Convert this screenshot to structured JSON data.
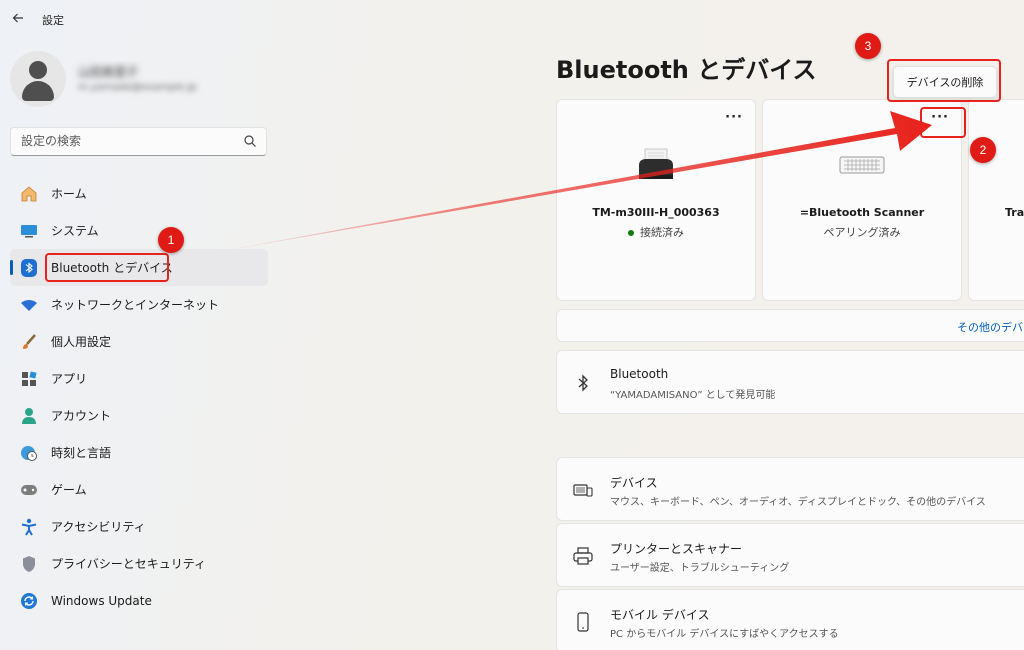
{
  "titlebar": {
    "back_icon": "back-arrow-icon",
    "title": "設定"
  },
  "profile": {
    "name": "山田美里子",
    "email": "m.yamada@example.jp"
  },
  "search": {
    "placeholder": "設定の検索",
    "icon": "search-icon"
  },
  "sidebar": {
    "items": [
      {
        "label": "ホーム",
        "icon": "home-icon"
      },
      {
        "label": "システム",
        "icon": "system-icon"
      },
      {
        "label": "Bluetooth とデバイス",
        "icon": "bluetooth-icon",
        "active": true
      },
      {
        "label": "ネットワークとインターネット",
        "icon": "wifi-icon"
      },
      {
        "label": "個人用設定",
        "icon": "brush-icon"
      },
      {
        "label": "アプリ",
        "icon": "apps-icon"
      },
      {
        "label": "アカウント",
        "icon": "account-icon"
      },
      {
        "label": "時刻と言語",
        "icon": "globe-clock-icon"
      },
      {
        "label": "ゲーム",
        "icon": "gamepad-icon"
      },
      {
        "label": "アクセシビリティ",
        "icon": "accessibility-icon"
      },
      {
        "label": "プライバシーとセキュリティ",
        "icon": "shield-icon"
      },
      {
        "label": "Windows Update",
        "icon": "update-icon"
      }
    ]
  },
  "main": {
    "title": "Bluetooth とデバイス",
    "remove_device_label": "デバイスの削除",
    "devices": [
      {
        "name": "TM-m30III-H_000363",
        "status": "接続済み",
        "connected": true,
        "more": "···"
      },
      {
        "name": "=Bluetooth Scanner",
        "status": "ペアリング済み",
        "connected": false,
        "more": "···"
      },
      {
        "name": "Trac",
        "status": "",
        "connected": false
      }
    ],
    "more_devices_label": "その他のデバ",
    "rows": [
      {
        "title": "Bluetooth",
        "subtitle": "“YAMADAMISANO” として発見可能",
        "icon": "bluetooth-icon"
      },
      {
        "title": "デバイス",
        "subtitle": "マウス、キーボード、ペン、オーディオ、ディスプレイとドック、その他のデバイス",
        "icon": "devices-icon"
      },
      {
        "title": "プリンターとスキャナー",
        "subtitle": "ユーザー設定、トラブルシューティング",
        "icon": "printer-icon"
      },
      {
        "title": "モバイル デバイス",
        "subtitle": "PC からモバイル デバイスにすばやくアクセスする",
        "icon": "phone-icon"
      }
    ]
  },
  "annotations": {
    "step1": "1",
    "step2": "2",
    "step3": "3",
    "color": "#e01b16"
  }
}
